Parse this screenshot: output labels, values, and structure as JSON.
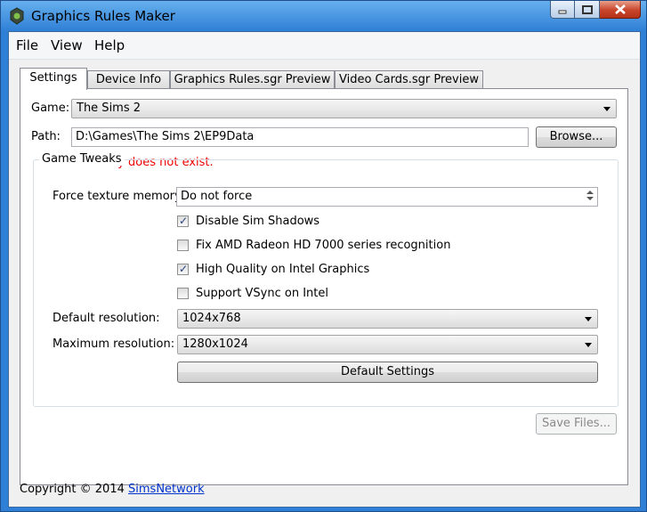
{
  "window": {
    "title": "Graphics Rules Maker",
    "icon": "app-icon"
  },
  "menu": [
    "File",
    "View",
    "Help"
  ],
  "tabs": [
    "Settings",
    "Device Info",
    "Graphics Rules.sgr Preview",
    "Video Cards.sgr Preview"
  ],
  "settings": {
    "game_label": "Game:",
    "game_value": "The Sims 2",
    "path_label": "Path:",
    "path_value": "D:\\Games\\The Sims 2\\EP9Data",
    "browse_label": "Browse...",
    "error": "Directory does not exist.",
    "group_title": "Game Tweaks",
    "texture_label": "Force texture memory:",
    "texture_value": "Do not force",
    "checks": [
      {
        "label": "Disable Sim Shadows",
        "checked": true
      },
      {
        "label": "Fix AMD Radeon HD 7000 series recognition",
        "checked": false
      },
      {
        "label": "High Quality on Intel Graphics",
        "checked": true
      },
      {
        "label": "Support VSync on Intel",
        "checked": false
      }
    ],
    "default_res_label": "Default resolution:",
    "default_res_value": "1024x768",
    "max_res_label": "Maximum resolution:",
    "max_res_value": "1280x1024",
    "default_settings_label": "Default Settings"
  },
  "save_label": "Save Files...",
  "footer": {
    "copyright": "Copyright © 2014",
    "link": "SimsNetwork"
  },
  "colors": {
    "error": "#e00000",
    "link": "#0033cc",
    "titlebar": "#2f7fd6"
  }
}
